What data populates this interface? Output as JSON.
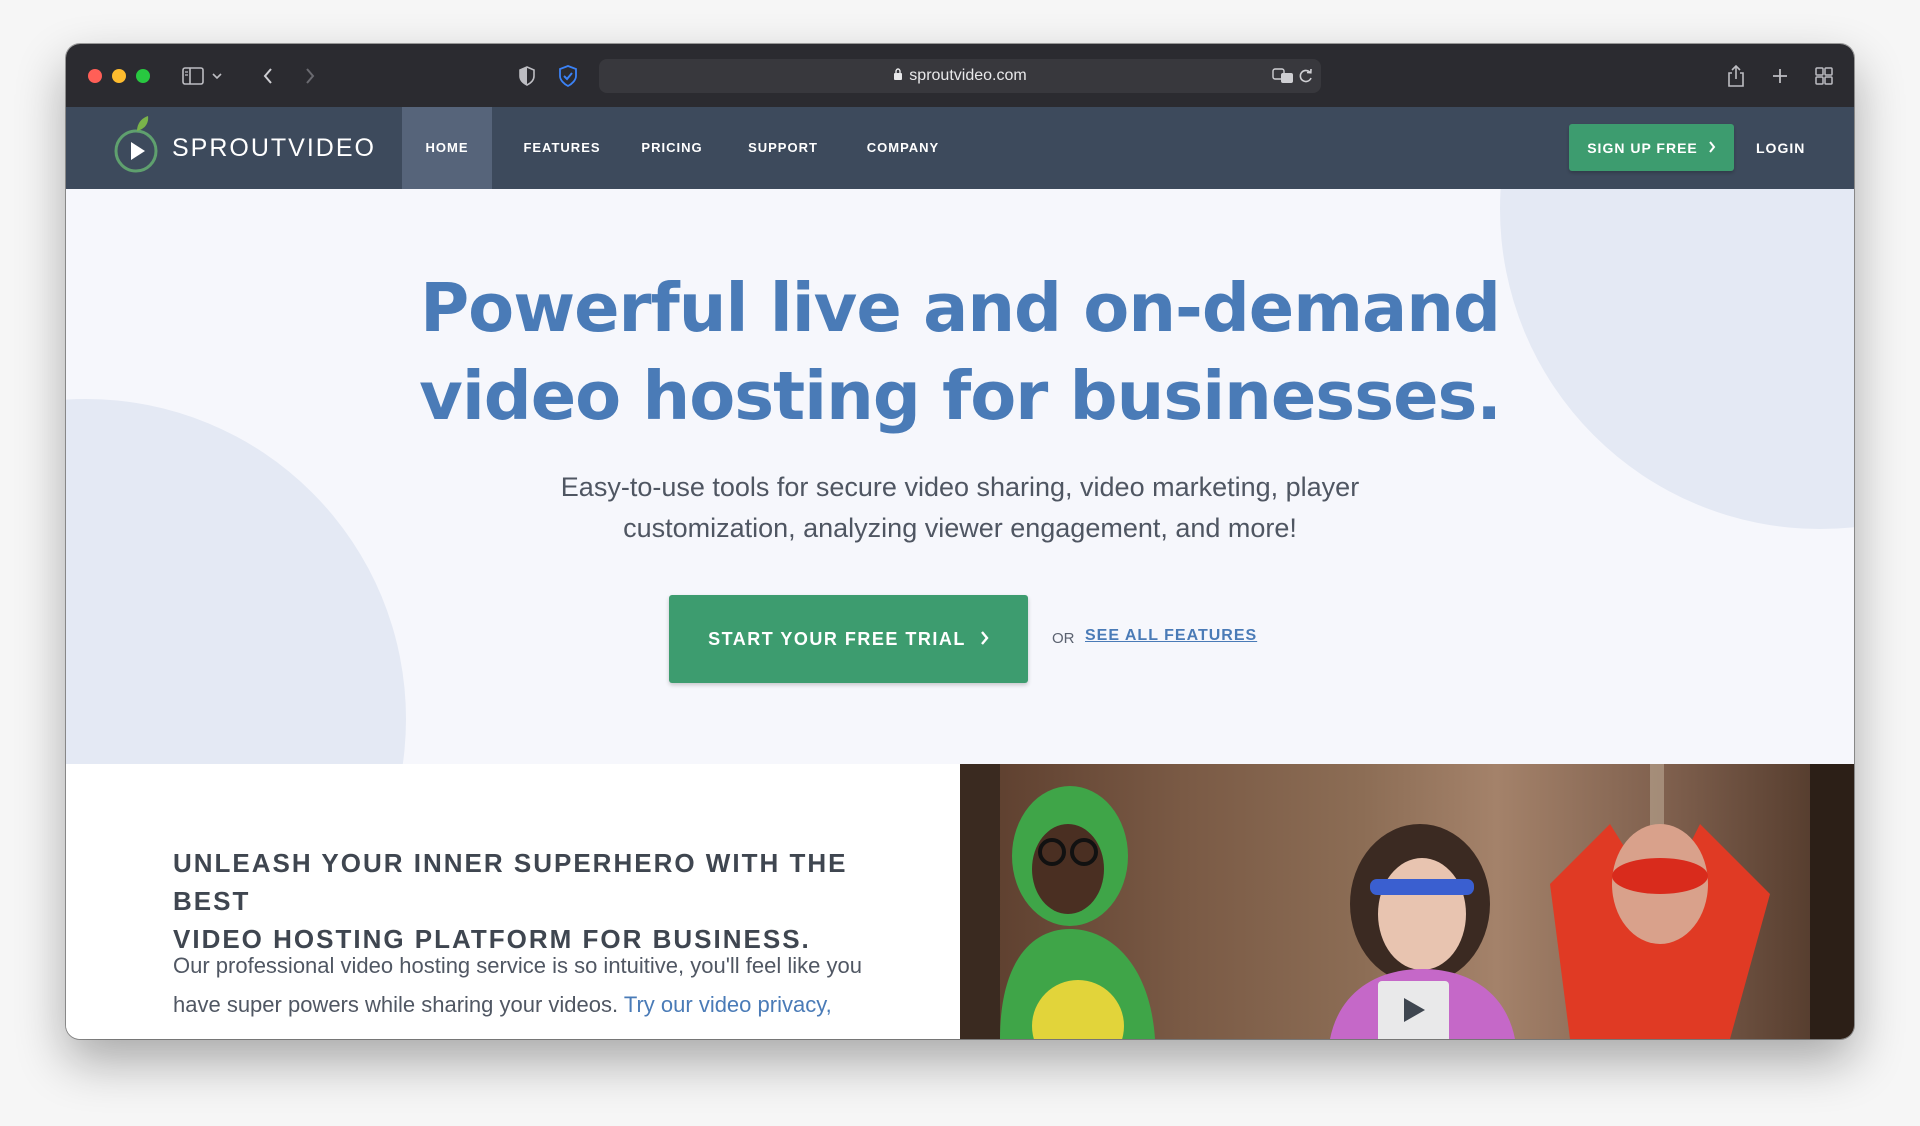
{
  "browser": {
    "url": "sproutvideo.com"
  },
  "site": {
    "logo_text": "SPROUTVIDEO",
    "nav": [
      {
        "label": "HOME",
        "active": true
      },
      {
        "label": "FEATURES",
        "active": false
      },
      {
        "label": "PRICING",
        "active": false
      },
      {
        "label": "SUPPORT",
        "active": false
      },
      {
        "label": "COMPANY",
        "active": false
      }
    ],
    "signup_label": "SIGN UP FREE",
    "login_label": "LOGIN"
  },
  "hero": {
    "headline_line1": "Powerful live and on-demand",
    "headline_line2": "video hosting for businesses.",
    "sub_line1": "Easy-to-use tools for secure video sharing, video marketing, player",
    "sub_line2": "customization, analyzing viewer engagement, and more!",
    "cta_label": "START YOUR FREE TRIAL",
    "or_text": "OR",
    "see_all_label": "SEE ALL FEATURES"
  },
  "lower": {
    "title_line1": "UNLEASH YOUR INNER SUPERHERO WITH THE BEST",
    "title_line2": "VIDEO HOSTING PLATFORM FOR BUSINESS.",
    "body_text": "Our professional video hosting service is so intuitive, you'll feel like you have super powers while sharing your videos.",
    "body_link": "Try our video privacy,"
  },
  "colors": {
    "nav_bg": "#3d4a5c",
    "accent_green": "#3d9c6f",
    "headline_blue": "#4a7bb7"
  }
}
